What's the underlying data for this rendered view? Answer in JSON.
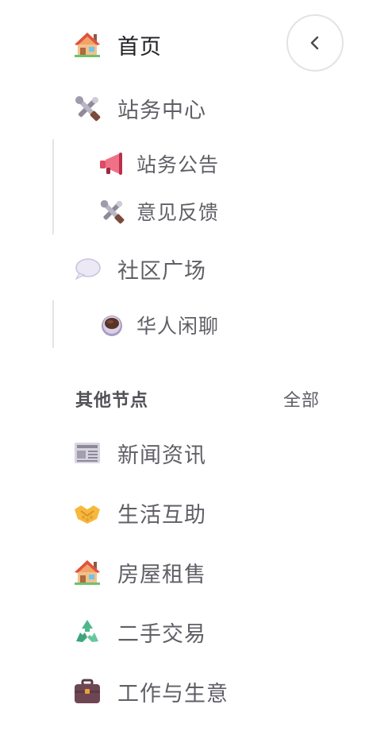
{
  "nav": {
    "home": {
      "label": "首页",
      "icon": "house-icon"
    },
    "station_center": {
      "label": "站务中心",
      "icon": "tools-icon",
      "children": [
        {
          "label": "站务公告",
          "icon": "megaphone-icon"
        },
        {
          "label": "意见反馈",
          "icon": "tools-icon"
        }
      ]
    },
    "community": {
      "label": "社区广场",
      "icon": "speech-bubble-icon",
      "children": [
        {
          "label": "华人闲聊",
          "icon": "coffee-icon"
        }
      ]
    }
  },
  "other_nodes": {
    "title": "其他节点",
    "all_link": "全部",
    "items": [
      {
        "label": "新闻资讯",
        "icon": "newspaper-icon"
      },
      {
        "label": "生活互助",
        "icon": "handshake-icon"
      },
      {
        "label": "房屋租售",
        "icon": "house-icon"
      },
      {
        "label": "二手交易",
        "icon": "recycle-icon"
      },
      {
        "label": "工作与生意",
        "icon": "briefcase-icon"
      }
    ]
  },
  "colors": {
    "active_text": "#1f1f24",
    "text": "#5f5f66",
    "divider": "#e3e3e8"
  }
}
